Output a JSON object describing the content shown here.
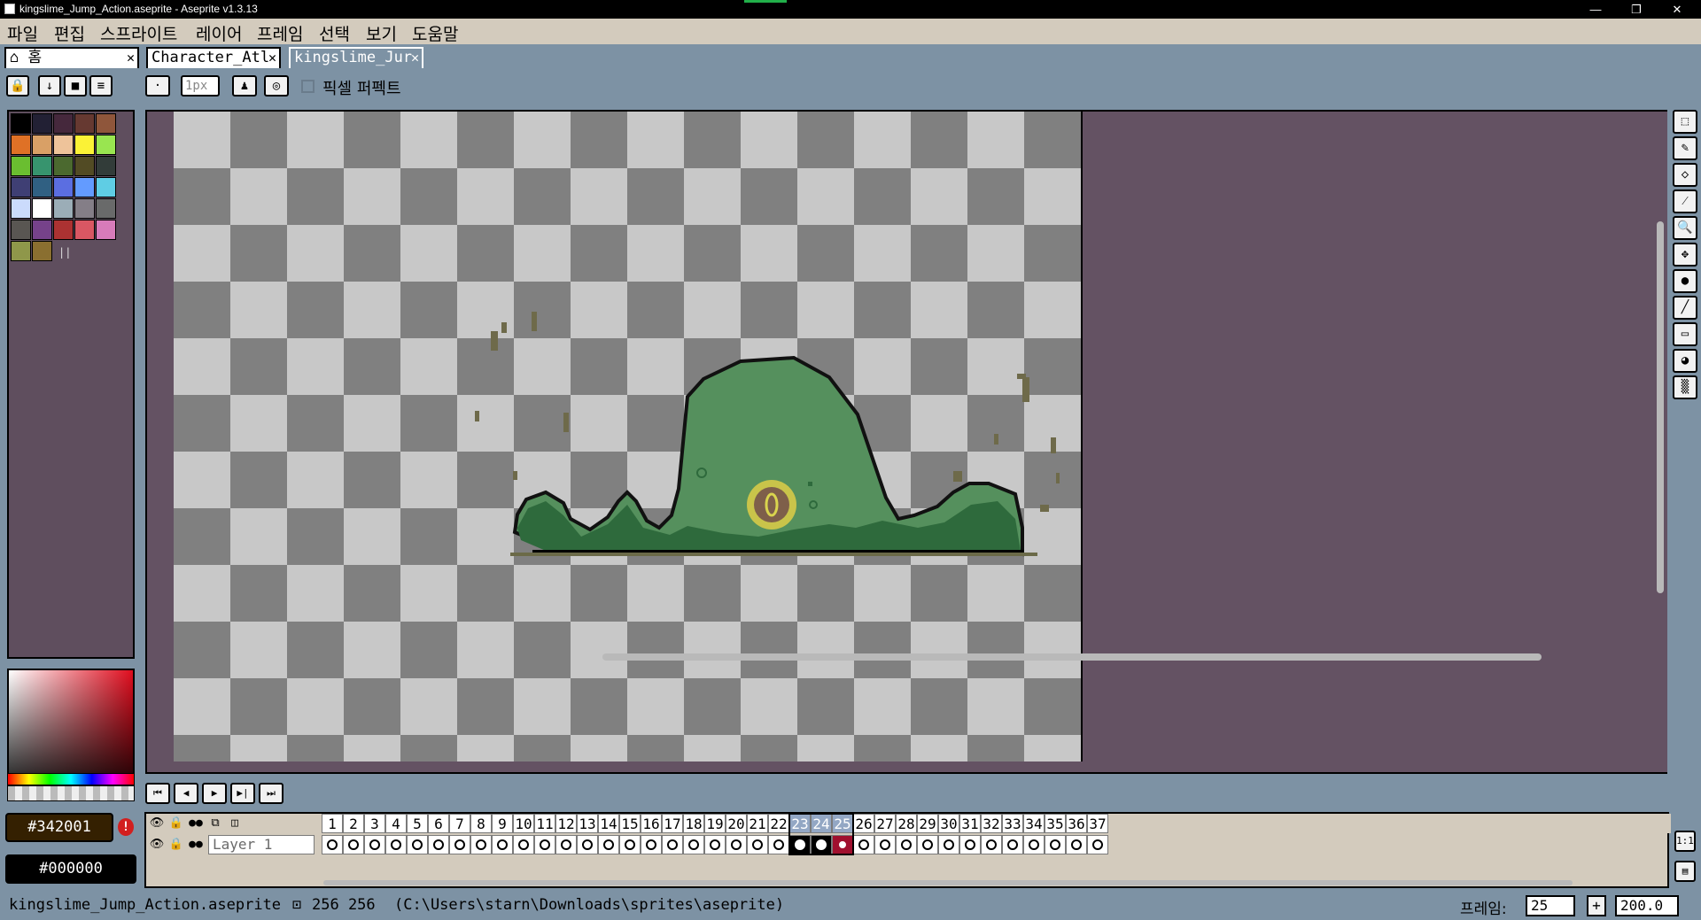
{
  "window": {
    "title": "kingslime_Jump_Action.aseprite - Aseprite v1.3.13",
    "minimize": "—",
    "restore": "❐",
    "close": "✕"
  },
  "menu": [
    "파일",
    "편집",
    "스프라이트",
    "레이어",
    "프레임",
    "선택",
    "보기",
    "도움말"
  ],
  "tabs": [
    {
      "label": "홈",
      "icon": "home-icon"
    },
    {
      "label": "Character_Atl"
    },
    {
      "label": "kingslime_Jur",
      "active": true
    }
  ],
  "toolbar": {
    "brush_size": "1px",
    "pixel_perfect_label": "픽셀 퍼펙트",
    "pixel_perfect_checked": false
  },
  "palette": [
    "#000000",
    "#222034",
    "#45283c",
    "#663931",
    "#8f563b",
    "#df7126",
    "#d9a066",
    "#eec39a",
    "#fbf236",
    "#99e550",
    "#6abe30",
    "#37946e",
    "#4b692f",
    "#524b24",
    "#323c39",
    "#3f3f74",
    "#306082",
    "#5b6ee1",
    "#639bff",
    "#5fcde4",
    "#cbdbfc",
    "#ffffff",
    "#9badb7",
    "#847e87",
    "#696a6a",
    "#595652",
    "#76428a",
    "#ac3232",
    "#d95763",
    "#d77bba",
    "#8f974a",
    "#8a6f30"
  ],
  "colors": {
    "foreground": "#342001",
    "background": "#000000",
    "accent_warning": "#d21f1f"
  },
  "sprite": {
    "name": "kingslime_Jump_Action.aseprite"
  },
  "timeline": {
    "frames": [
      "1",
      "2",
      "3",
      "4",
      "5",
      "6",
      "7",
      "8",
      "9",
      "10",
      "11",
      "12",
      "13",
      "14",
      "15",
      "16",
      "17",
      "18",
      "19",
      "20",
      "21",
      "22",
      "23",
      "24",
      "25",
      "26",
      "27",
      "28",
      "29",
      "30",
      "31",
      "32",
      "33",
      "34",
      "35",
      "36",
      "37"
    ],
    "selected_frames": [
      "23",
      "24",
      "25"
    ],
    "current_frame": "25",
    "layer": "Layer 1",
    "zoom_reset": "1:1"
  },
  "status": {
    "filename": "kingslime_Jump_Action.aseprite",
    "size": "256 256",
    "path": "(C:\\Users\\starn\\Downloads\\sprites\\aseprite)",
    "frame_label": "프레임:",
    "frame_value": "25",
    "add_frame": "+",
    "zoom": "200.0"
  }
}
